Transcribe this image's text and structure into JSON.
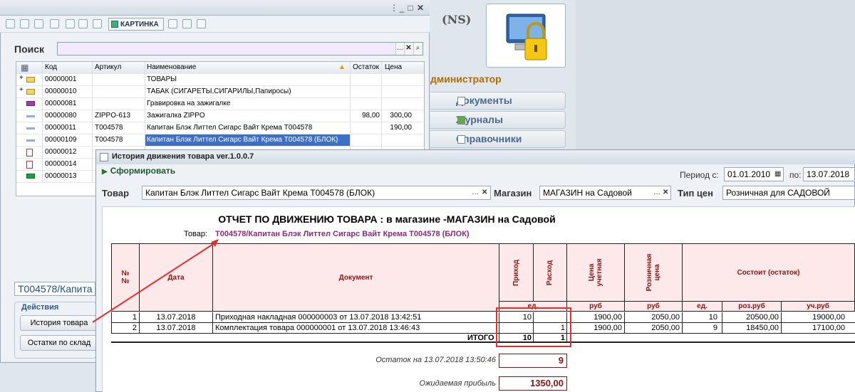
{
  "background_app": {
    "brand": "(NS)",
    "admin_label": "дминистратор",
    "nav": [
      {
        "label": "Документы",
        "icon": "documents-icon"
      },
      {
        "label": "Журналы",
        "icon": "journals-icon"
      },
      {
        "label": "Справочники",
        "icon": "catalogs-icon"
      }
    ],
    "lock_icon": "lock-computer-icon"
  },
  "list_window": {
    "toolbar_picture_label": "КАРТИНКА",
    "search_label": "Поиск",
    "search_value": "",
    "columns": [
      "Код",
      "Артикул",
      "Наименование",
      "Остаток",
      "Цена"
    ],
    "rows": [
      {
        "icon": "folder",
        "code": "00000001",
        "article": "",
        "name": "ТОВАРЫ",
        "stock": "",
        "price": ""
      },
      {
        "icon": "folder",
        "code": "00000010",
        "article": "",
        "name": "ТАБАК (СИГАРЕТЫ,СИГАРИЛЫ,Папиросы)",
        "stock": "",
        "price": ""
      },
      {
        "icon": "service",
        "code": "00000081",
        "article": "",
        "name": "Гравировка на зажигалке",
        "stock": "",
        "price": ""
      },
      {
        "icon": "item",
        "code": "00000080",
        "article": "ZIPPO-613",
        "name": "Зажигалка ZIPPO",
        "stock": "98,00",
        "price": "300,00"
      },
      {
        "icon": "item",
        "code": "00000011",
        "article": "T004578",
        "name": "Капитан Блэк Литтел Сигарс Вайт Крема T004578",
        "stock": "",
        "price": "190,00"
      },
      {
        "icon": "item",
        "code": "00000109",
        "article": "T004578",
        "name": "Капитан Блэк Литтел Сигарс Вайт Крема T004578 (БЛОК)",
        "stock": "",
        "price": ""
      },
      {
        "icon": "set",
        "code": "00000012",
        "article": "",
        "name": "",
        "stock": "",
        "price": ""
      },
      {
        "icon": "set",
        "code": "00000014",
        "article": "",
        "name": "",
        "stock": "",
        "price": ""
      },
      {
        "icon": "green",
        "code": "00000013",
        "article": "",
        "name": "",
        "stock": "",
        "price": ""
      }
    ],
    "selected_code": "T004578/Капита",
    "actions_label": "Действия",
    "actions": [
      "История товара",
      "Остатки по склад"
    ]
  },
  "report_window": {
    "title": "История движения товара ver.1.0.0.7",
    "generate_label": "Сформировать",
    "period_from_label": "Период с:",
    "period_from": "01.01.2010",
    "period_to_label": "по:",
    "period_to": "13.07.2018",
    "product_label": "Товар",
    "product_value": "Капитан Блэк Литтел Сигарс Вайт Крема T004578 (БЛОК)",
    "store_label": "Магазин",
    "store_value": "МАГАЗИН на Садовой",
    "price_type_label": "Тип цен",
    "price_type_value": "Розничная для САДОВОЙ",
    "report": {
      "title": "ОТЧЕТ ПО ДВИЖЕНИЮ ТОВАРА : в магазине -МАГАЗИН на Садовой",
      "product_label": "Товар:",
      "product_value": "T004578/Капитан Блэк Литтел Сигарс Вайт Крема T004578 (БЛОК)",
      "headers": {
        "num": "№ №",
        "date": "Дата",
        "document": "Документ",
        "income": "Приход",
        "expense": "Расход",
        "acc_price": "Цена учетная",
        "retail_price": "Розничная цена",
        "consists": "Состоит (остаток)",
        "unit": "ед.",
        "rub": "руб",
        "unit2": "ед.",
        "retail_rub": "роз.руб",
        "acc_rub": "уч.руб"
      },
      "rows": [
        {
          "n": "1",
          "date": "13.07.2018",
          "doc": "Приходная накладная 000000003 от 13.07.2018 13:42:51",
          "income": "10",
          "expense": "",
          "acc_price": "1900,00",
          "retail_price": "2050,00",
          "qty": "10",
          "retail_sum": "20500,00",
          "acc_sum": "19000,00"
        },
        {
          "n": "2",
          "date": "13.07.2018",
          "doc": "Комплектация товара 000000001 от 13.07.2018 13:46:43",
          "income": "",
          "expense": "1",
          "acc_price": "1900,00",
          "retail_price": "2050,00",
          "qty": "9",
          "retail_sum": "18450,00",
          "acc_sum": "17100,00"
        }
      ],
      "total_label": "ИТОГО",
      "total_income": "10",
      "total_expense": "1",
      "balance_label": "Остаток на 13.07.2018 13:50:46",
      "balance_value": "9",
      "profit_label": "Ожидаемая прибыль",
      "profit_value": "1350,00"
    }
  },
  "colors": {
    "accent_red": "#e23030",
    "header_fill": "#fde9ea",
    "header_text": "#8a1212",
    "selection": "#3d6fc7"
  }
}
